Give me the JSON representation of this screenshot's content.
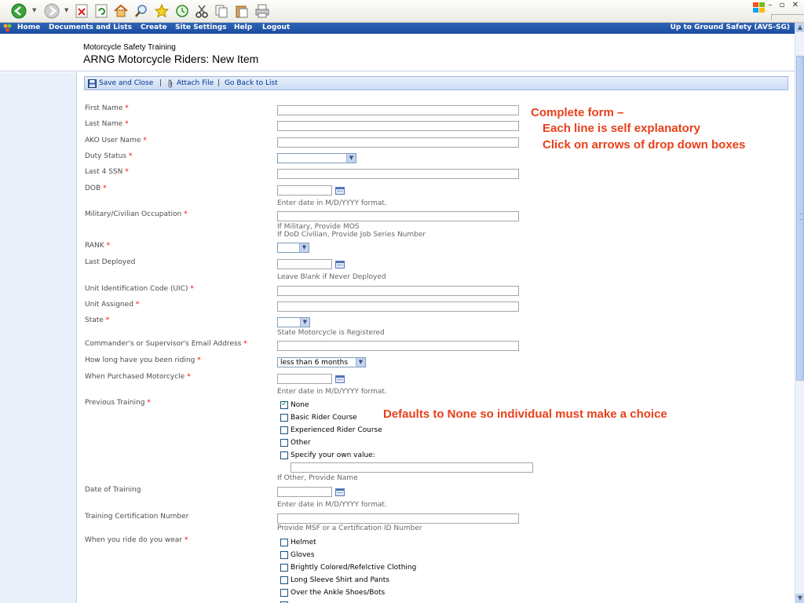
{
  "browser": {
    "window_controls": "– ▫ ✕"
  },
  "navbar": {
    "items": [
      "Home",
      "Documents and Lists",
      "Create",
      "Site Settings",
      "Help",
      "Logout"
    ],
    "site_link": "Up to Ground Safety (AVS-SG)"
  },
  "header": {
    "breadcrumb": "Motorcycle Safety Training",
    "title": "ARNG Motorcycle Riders: New Item"
  },
  "toolbar": {
    "save_close": "Save and Close",
    "attach_file": "Attach File",
    "go_back": "Go Back to List",
    "separator": "|"
  },
  "form": {
    "required_marker": "*",
    "first_name": "First Name",
    "last_name": "Last Name",
    "ako_user": "AKO User Name",
    "duty_status": "Duty Status",
    "last4_ssn": "Last 4 SSN",
    "dob": "DOB",
    "date_hint": "Enter date in M/D/YYYY format.",
    "occupation": "Military/Civilian Occupation",
    "occupation_hint1": "If Military, Provide MOS",
    "occupation_hint2": "If DoD Civilian, Provide Job Series Number",
    "rank": "RANK",
    "last_deployed": "Last Deployed",
    "last_deployed_hint": "Leave Blank if Never Deployed",
    "uic": "Unit Identification Code (UIC)",
    "unit_assigned": "Unit Assigned",
    "state": "State",
    "state_hint": "State Motorcycle is Registered",
    "commander_email": "Commander's or Supervisor's Email Address",
    "riding_duration": "How long have you been riding",
    "riding_duration_value": "less than 6 months",
    "purchased": "When Purchased Motorcycle",
    "previous_training": "Previous Training",
    "training_options": [
      "None",
      "Basic Rider Course",
      "Experienced Rider Course",
      "Other",
      "Specify your own value:"
    ],
    "training_other_hint": "If Other, Provide Name",
    "date_of_training": "Date of Training",
    "cert_number": "Training Certification Number",
    "cert_hint": "Provide MSF or a Certification ID Number",
    "ride_wear": "When you ride do you wear",
    "wear_options": [
      "Helmet",
      "Gloves",
      "Brightly Colored/Refelctive Clothing",
      "Long Sleeve Shirt and Pants",
      "Over the Ankle Shoes/Bots"
    ]
  },
  "annotations": {
    "line1": "Complete form –",
    "line2": "Each line is self explanatory",
    "line3": "Click on arrows of drop down boxes",
    "defaults_note": "Defaults to None so individual must make a choice"
  },
  "colors": {
    "navbar": "#1b4c9f",
    "annotation": "#e8401a",
    "required": "#ff0000"
  }
}
